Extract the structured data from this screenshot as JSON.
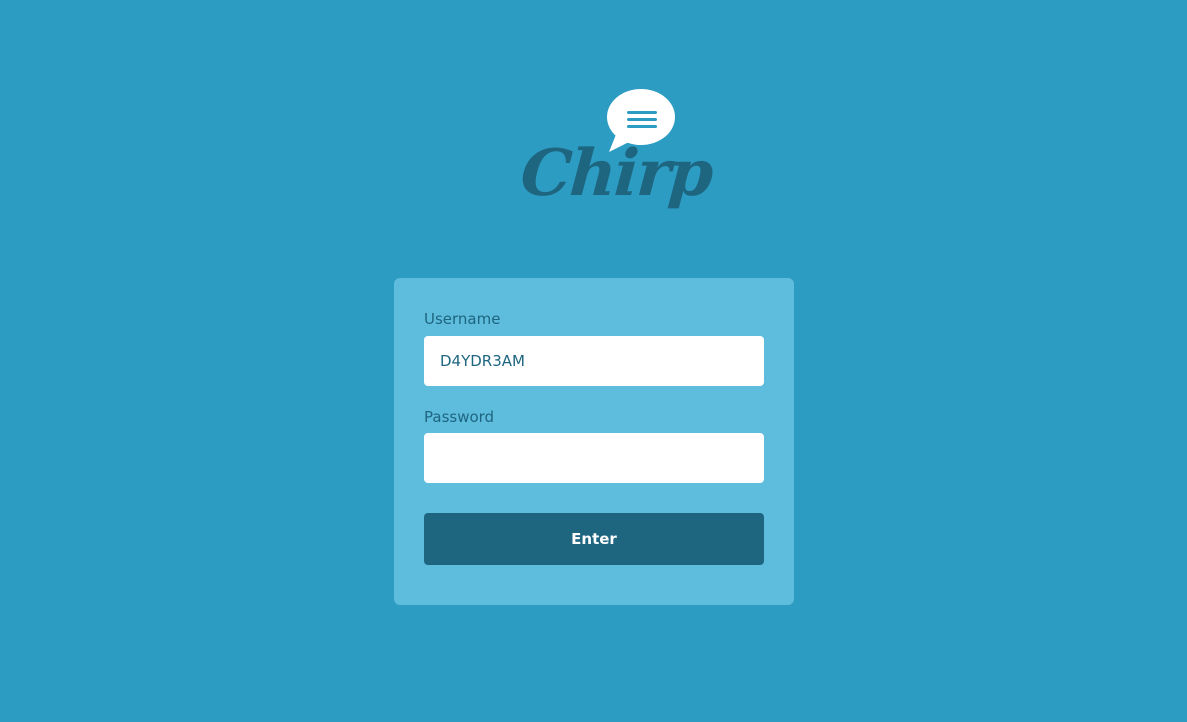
{
  "app": {
    "logo_text": "Chirp",
    "logo_icon": "speech-bubble-icon"
  },
  "form": {
    "username_label": "Username",
    "username_value": "D4YDR3AM",
    "password_label": "Password",
    "password_value": "",
    "submit_label": "Enter"
  },
  "colors": {
    "background": "#2d9cc3",
    "card": "#5ebcdd",
    "primary_dark": "#1e6580",
    "input_bg": "#ffffff"
  }
}
